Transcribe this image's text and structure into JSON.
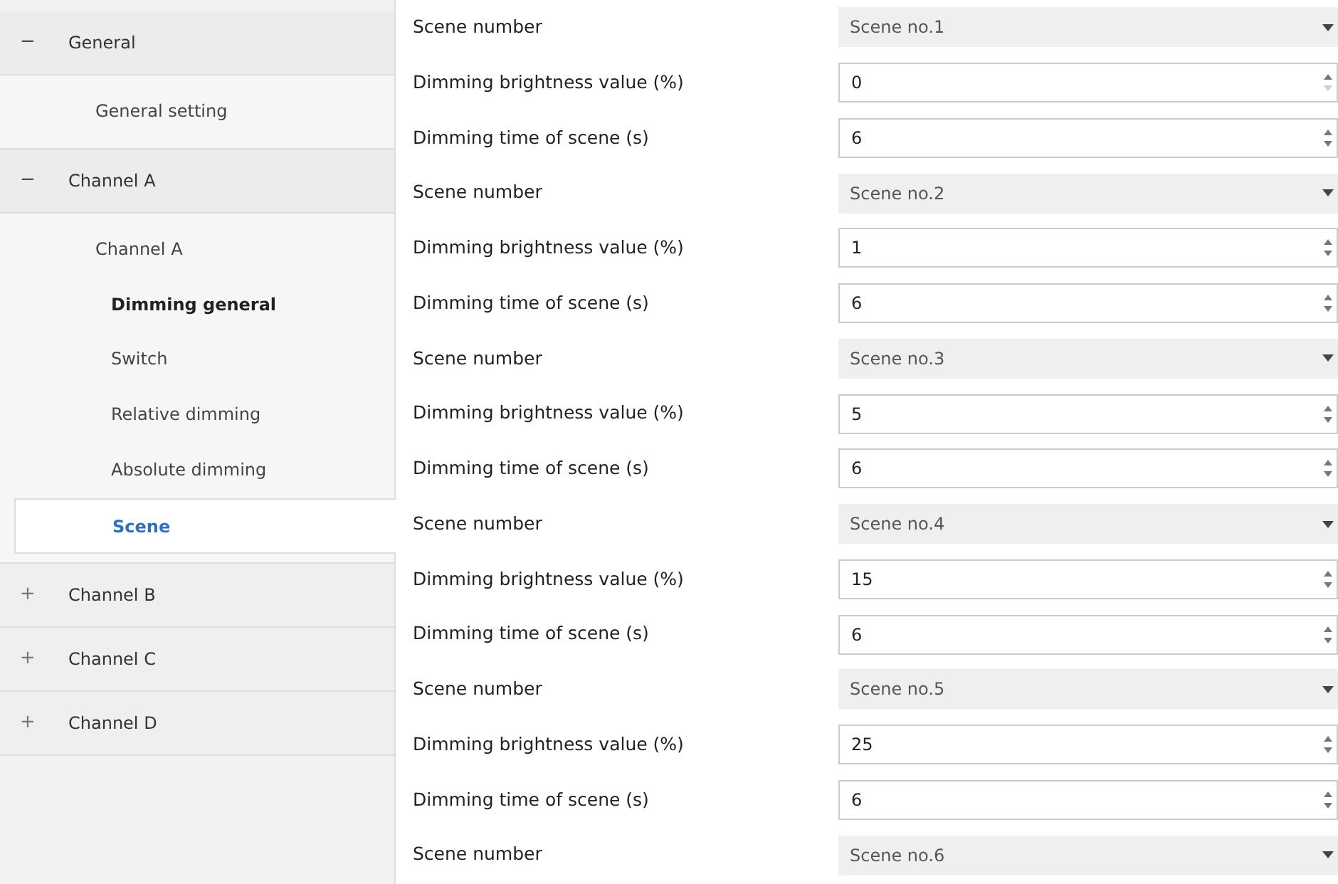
{
  "sidebar": {
    "groups": [
      {
        "expander": "−",
        "label": "General",
        "expanded": true,
        "children": [
          {
            "label": "General setting",
            "selected": false,
            "bold": false
          }
        ]
      },
      {
        "expander": "−",
        "label": "Channel A",
        "expanded": true,
        "children": [
          {
            "label": "Channel A",
            "selected": false,
            "bold": false,
            "children": [
              {
                "label": "Dimming general",
                "selected": false,
                "bold": true
              },
              {
                "label": "Switch",
                "selected": false,
                "bold": false
              },
              {
                "label": "Relative dimming",
                "selected": false,
                "bold": false
              },
              {
                "label": "Absolute dimming",
                "selected": false,
                "bold": false
              },
              {
                "label": "Scene",
                "selected": true,
                "bold": false
              }
            ]
          }
        ]
      },
      {
        "expander": "+",
        "label": "Channel B",
        "expanded": false
      },
      {
        "expander": "+",
        "label": "Channel C",
        "expanded": false
      },
      {
        "expander": "+",
        "label": "Channel D",
        "expanded": false
      }
    ]
  },
  "parameters": [
    {
      "label": "Scene number",
      "kind": "dropdown",
      "value": "Scene no.1"
    },
    {
      "label": "Dimming brightness value (%)",
      "kind": "spin",
      "value": "0",
      "at_minimum": true
    },
    {
      "label": "Dimming time of scene (s)",
      "kind": "spin",
      "value": "6",
      "at_minimum": false
    },
    {
      "label": "Scene number",
      "kind": "dropdown",
      "value": "Scene no.2"
    },
    {
      "label": "Dimming brightness value (%)",
      "kind": "spin",
      "value": "1",
      "at_minimum": false
    },
    {
      "label": "Dimming time of scene (s)",
      "kind": "spin",
      "value": "6",
      "at_minimum": false
    },
    {
      "label": "Scene number",
      "kind": "dropdown",
      "value": "Scene no.3"
    },
    {
      "label": "Dimming brightness value (%)",
      "kind": "spin",
      "value": "5",
      "at_minimum": false
    },
    {
      "label": "Dimming time of scene (s)",
      "kind": "spin",
      "value": "6",
      "at_minimum": false
    },
    {
      "label": "Scene number",
      "kind": "dropdown",
      "value": "Scene no.4"
    },
    {
      "label": "Dimming brightness value (%)",
      "kind": "spin",
      "value": "15",
      "at_minimum": false
    },
    {
      "label": "Dimming time of scene (s)",
      "kind": "spin",
      "value": "6",
      "at_minimum": false
    },
    {
      "label": "Scene number",
      "kind": "dropdown",
      "value": "Scene no.5"
    },
    {
      "label": "Dimming brightness value (%)",
      "kind": "spin",
      "value": "25",
      "at_minimum": false
    },
    {
      "label": "Dimming time of scene (s)",
      "kind": "spin",
      "value": "6",
      "at_minimum": false
    },
    {
      "label": "Scene number",
      "kind": "dropdown",
      "value": "Scene no.6"
    }
  ]
}
